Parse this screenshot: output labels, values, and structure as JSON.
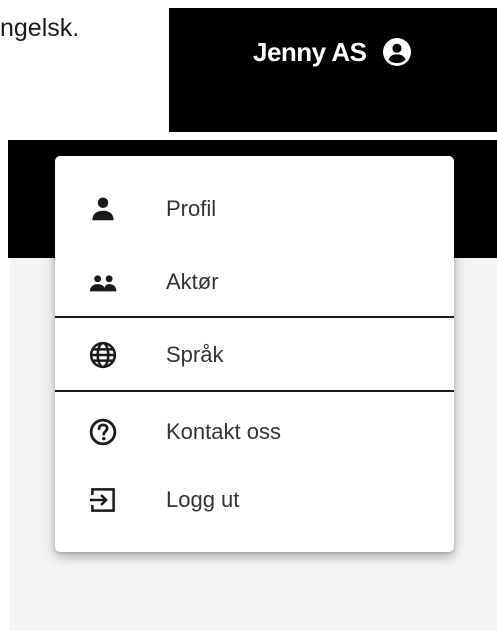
{
  "background": {
    "partial_text": "ngelsk."
  },
  "header": {
    "user_name": "Jenny AS",
    "user_icon": "account-circle-icon",
    "background_color": "#000000",
    "text_color": "#ffffff"
  },
  "menu": {
    "items": [
      {
        "label": "Profil",
        "icon": "person-icon"
      },
      {
        "label": "Aktør",
        "icon": "group-icon"
      },
      {
        "label": "Språk",
        "icon": "globe-icon"
      },
      {
        "label": "Kontakt oss",
        "icon": "help-circle-icon"
      },
      {
        "label": "Logg ut",
        "icon": "logout-icon"
      }
    ]
  }
}
